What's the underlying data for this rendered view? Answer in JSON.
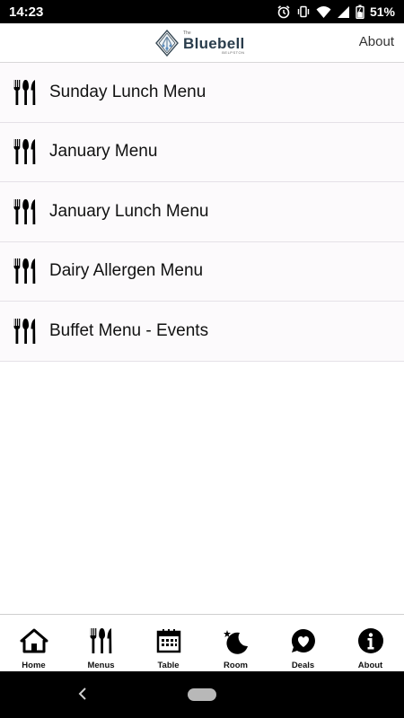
{
  "status_bar": {
    "time": "14:23",
    "battery": "51%"
  },
  "header": {
    "logo_the": "The",
    "logo_name": "Bluebell",
    "logo_sub": "BELPSTON",
    "about_label": "About"
  },
  "menus": [
    {
      "label": "Sunday Lunch Menu"
    },
    {
      "label": "January Menu"
    },
    {
      "label": "January Lunch Menu"
    },
    {
      "label": "Dairy Allergen Menu"
    },
    {
      "label": "Buffet Menu - Events"
    }
  ],
  "bottom_nav": [
    {
      "label": "Home",
      "icon": "home-icon"
    },
    {
      "label": "Menus",
      "icon": "cutlery-icon"
    },
    {
      "label": "Table",
      "icon": "calendar-icon"
    },
    {
      "label": "Room",
      "icon": "moon-star-icon"
    },
    {
      "label": "Deals",
      "icon": "heart-icon"
    },
    {
      "label": "About",
      "icon": "info-icon"
    }
  ]
}
